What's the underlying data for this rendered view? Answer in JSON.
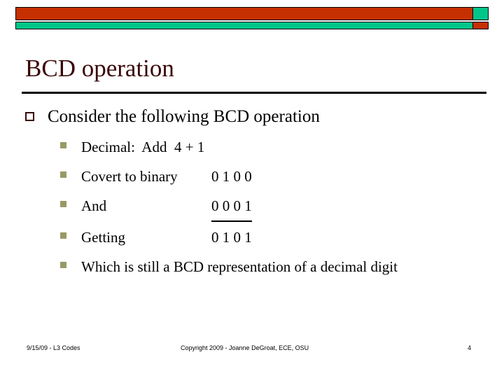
{
  "theme": {
    "accent_red": "#c63000",
    "accent_teal": "#00c68a",
    "title_color": "#3a0808",
    "bullet_lvl2_color": "#999966",
    "background": "#ffffff"
  },
  "slide": {
    "title": "BCD operation",
    "bullet_level1": {
      "marker": "hollow-square",
      "text": "Consider the following BCD operation"
    },
    "sub_bullets": [
      {
        "marker": "filled-square",
        "label": "Decimal:  Add  4 + 1",
        "value": "",
        "underlined": false,
        "wraps": false
      },
      {
        "marker": "filled-square",
        "label": "Covert to binary",
        "value": "0 1 0 0",
        "underlined": false,
        "wraps": false
      },
      {
        "marker": "filled-square",
        "label": "And",
        "value": "0 0 0 1",
        "underlined": true,
        "wraps": false
      },
      {
        "marker": "filled-square",
        "label": "Getting",
        "value": "0 1 0 1",
        "underlined": false,
        "wraps": false
      },
      {
        "marker": "filled-square",
        "label": "Which is still a BCD representation of a decimal digit",
        "value": "",
        "underlined": false,
        "wraps": true
      }
    ]
  },
  "footer": {
    "left": "9/15/09 - L3 Codes",
    "center": "Copyright 2009 -  Joanne DeGroat, ECE, OSU",
    "page_number": "4"
  }
}
